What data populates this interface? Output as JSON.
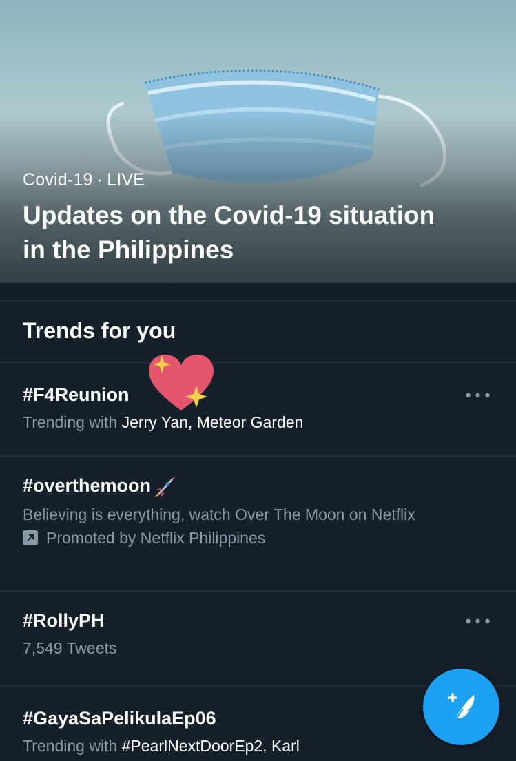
{
  "hero": {
    "category": "Covid-19",
    "separator": "·",
    "status": "LIVE",
    "title": "Updates on the Covid-19 situation in the Philippines",
    "image": "surgical-mask-photo"
  },
  "section": {
    "title": "Trends for you"
  },
  "trends": [
    {
      "name": "#F4Reunion",
      "sub_prefix": "Trending with",
      "sub_highlight": "Jerry Yan, Meteor Garden",
      "more": "•••",
      "emoji": "sparkling-heart"
    },
    {
      "name": "#overthemoon",
      "emoji": "rocket",
      "description": "Believing is everything, watch Over The Moon on Netflix",
      "promoted": "Promoted by Netflix Philippines"
    },
    {
      "name": "#RollyPH",
      "tweets": "7,549 Tweets",
      "more": "•••"
    },
    {
      "name": "#GayaSaPelikulaEp06",
      "sub_prefix": "Trending with",
      "sub_highlight": "#PearlNextDoorEp2, Karl"
    }
  ],
  "fab": {
    "icon": "compose-tweet-icon",
    "color": "#1da1f2"
  },
  "colors": {
    "background": "#15202b",
    "secondary_text": "#8899a6",
    "divider": "#2f3b47"
  }
}
